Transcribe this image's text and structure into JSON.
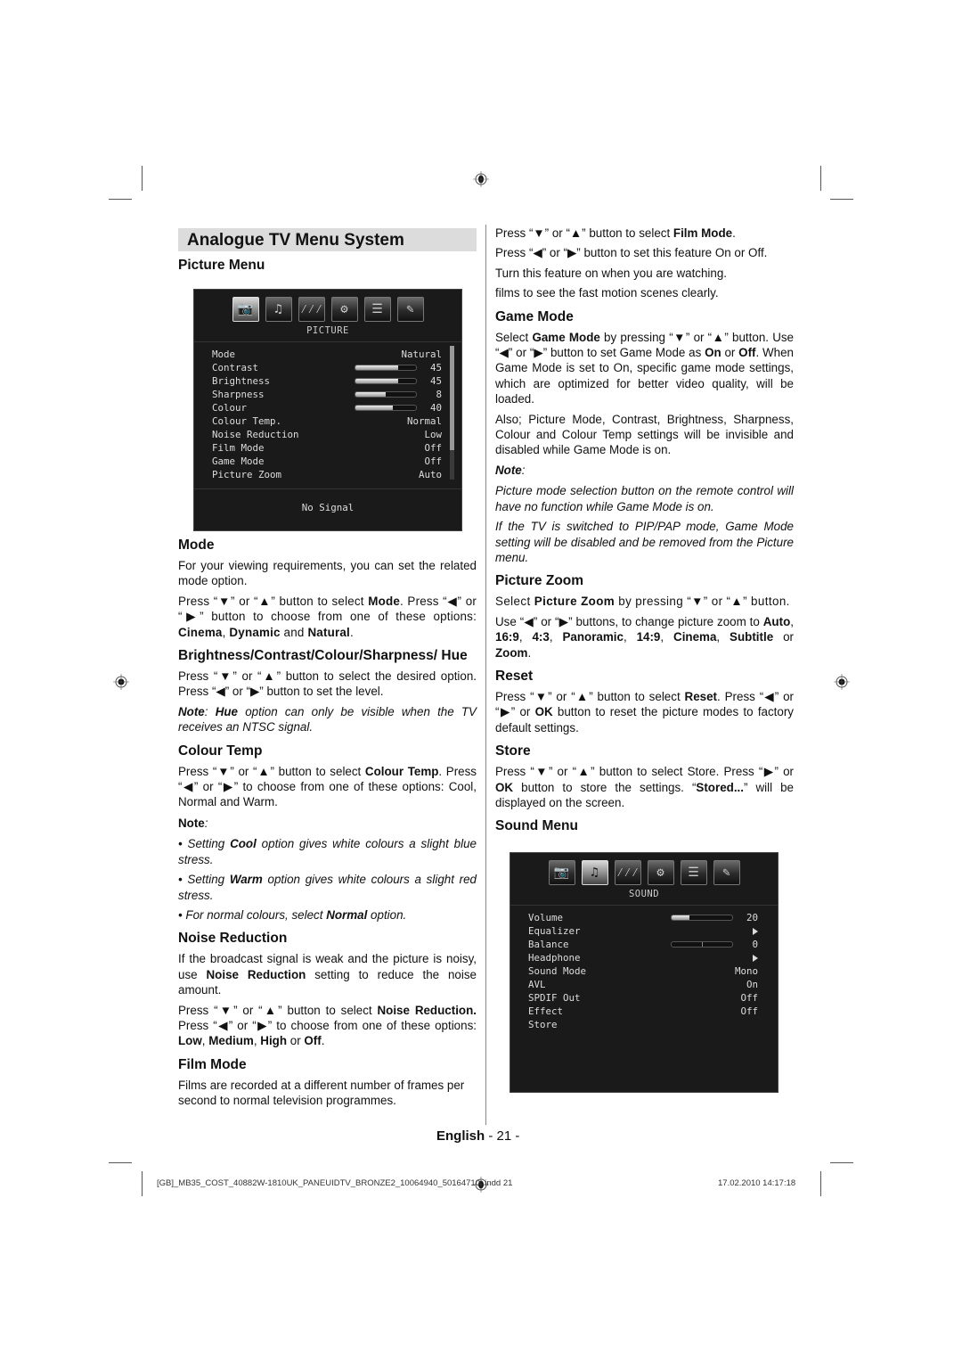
{
  "header": {
    "title": "Analogue TV Menu System",
    "subtitle": "Picture Menu"
  },
  "picture_osd": {
    "icons": [
      "camera-icon",
      "music-note-icon",
      "rain-lines-icon",
      "gears-icon",
      "document-list-icon",
      "tools-icon"
    ],
    "selected_icon": 0,
    "category": "PICTURE",
    "rows": [
      {
        "label": "Mode",
        "value": "Natural"
      },
      {
        "label": "Contrast",
        "value": "45",
        "level": 0.7
      },
      {
        "label": "Brightness",
        "value": "45",
        "level": 0.7
      },
      {
        "label": "Sharpness",
        "value": "8",
        "level": 0.5
      },
      {
        "label": "Colour",
        "value": "40",
        "level": 0.62
      },
      {
        "label": "Colour Temp.",
        "value": "Normal"
      },
      {
        "label": "Noise Reduction",
        "value": "Low"
      },
      {
        "label": "Film Mode",
        "value": "Off"
      },
      {
        "label": "Game Mode",
        "value": "Off"
      },
      {
        "label": "Picture Zoom",
        "value": "Auto"
      }
    ],
    "status": "No Signal",
    "scroll_fraction": 0.78
  },
  "left": {
    "mode": {
      "heading": "Mode",
      "p1": "For your viewing requirements, you can set the related mode option.",
      "p2_a": "Press “▼” or “▲” button to select ",
      "p2_b": "Mode",
      "p2_c": ". Press “◀” or “▶” button to choose from one of these options: ",
      "p2_d": "Cinema",
      "p2_e": ",  ",
      "p2_f": "Dynamic",
      "p2_g": " and ",
      "p2_h": "Natural",
      "p2_i": "."
    },
    "bcsh": {
      "heading": "Brightness/Contrast/Colour/Sharpness/ Hue",
      "p1": "Press “▼” or “▲” button to select the desired option. Press “◀” or “▶” button to set the level.",
      "note_a": "Note",
      "note_b": ": ",
      "note_c": "Hue",
      "note_d": " option can only be visible when the TV receives an NTSC signal."
    },
    "colour_temp": {
      "heading": "Colour Temp",
      "p1_a": "Press “▼” or “▲” button to select ",
      "p1_b": "Colour Temp",
      "p1_c": ". Press “◀” or “▶” to choose from one of these options: Cool, Normal and Warm.",
      "note": "Note",
      "note_colon": ":",
      "b1_a": "• Setting ",
      "b1_b": "Cool",
      "b1_c": " option gives white colours a slight blue stress.",
      "b2_a": "• Setting ",
      "b2_b": "Warm",
      "b2_c": " option gives white colours a slight red stress.",
      "b3_a": "• For normal colours, select ",
      "b3_b": "Normal",
      "b3_c": " option."
    },
    "noise": {
      "heading": "Noise Reduction",
      "p1_a": "If the broadcast signal is weak and the picture is noisy, use ",
      "p1_b": "Noise Reduction",
      "p1_c": " setting to reduce the noise amount.",
      "p2_a": "Press “▼” or “▲” button to select ",
      "p2_b": "Noise Reduction.",
      "p2_c": " Press “◀” or “▶” to choose from one of these options: ",
      "p2_d": "Low",
      "p2_e": ", ",
      "p2_f": "Medium",
      "p2_g": ", ",
      "p2_h": "High",
      "p2_i": " or ",
      "p2_j": "Off",
      "p2_k": "."
    },
    "film": {
      "heading": "Film Mode",
      "p1": "Films are recorded at a different number of frames per second to normal television programmes."
    }
  },
  "right": {
    "film_cont": {
      "l1_a": "Press “▼” or “▲” button to select ",
      "l1_b": "Film Mode",
      "l1_c": ".",
      "l2": "Press “◀” or “▶” button to set this feature On or Off.",
      "l3": "Turn this feature on when you are watching.",
      "l4": "films to see the fast motion scenes clearly."
    },
    "game": {
      "heading": "Game Mode",
      "p1_a": "Select ",
      "p1_b": "Game Mode",
      "p1_c": " by pressing “▼” or “▲” button. Use “◀” or “▶” button to set Game Mode as ",
      "p1_d": "On",
      "p1_e": " or ",
      "p1_f": "Off",
      "p1_g": ". When Game Mode is set to On, specific game mode settings, which are optimized for better video quality, will be loaded.",
      "p2": "Also; Picture Mode, Contrast, Brightness, Sharpness, Colour and Colour Temp settings will be invisible and disabled while Game Mode is on.",
      "note": "Note",
      "note_colon": ":",
      "n1": "Picture mode selection button on the remote control will have no function while Game Mode is on.",
      "n2": "If the TV is switched to PIP/PAP mode, Game Mode setting will be disabled and be removed from the Picture menu."
    },
    "zoom": {
      "heading": "Picture Zoom",
      "p1_a": "Select ",
      "p1_b": "Picture Zoom",
      "p1_c": " by pressing “▼” or “▲” button.",
      "p2_a": "Use “◀” or “▶” buttons, to change picture zoom  to ",
      "opts": [
        "Auto",
        "16:9",
        "4:3",
        "Panoramic",
        "14:9",
        "Cinema",
        "Subtitle"
      ],
      "p2_or": " or ",
      "p2_last": "Zoom",
      "p2_end": "."
    },
    "reset": {
      "heading": "Reset",
      "p1_a": "Press “▼” or “▲” button to select ",
      "p1_b": "Reset",
      "p1_c": ". Press “◀” or “▶” or ",
      "p1_d": "OK",
      "p1_e": " button to reset the picture modes to factory default settings."
    },
    "store": {
      "heading": "Store",
      "p1_a": "Press “▼” or “▲” button to select Store. Press “▶” or ",
      "p1_b": "OK",
      "p1_c": " button to store the settings. “",
      "p1_d": "Stored...",
      "p1_e": "” will be displayed on the screen."
    },
    "sound_heading": "Sound Menu"
  },
  "sound_osd": {
    "icons": [
      "camera-icon",
      "music-note-icon",
      "rain-lines-icon",
      "gears-icon",
      "document-list-icon",
      "tools-icon"
    ],
    "selected_icon": 1,
    "category": "SOUND",
    "rows": [
      {
        "label": "Volume",
        "value": "20",
        "level": 0.3
      },
      {
        "label": "Equalizer",
        "arrow": true
      },
      {
        "label": "Balance",
        "value": "0",
        "balance": true
      },
      {
        "label": "Headphone",
        "arrow": true
      },
      {
        "label": "Sound Mode",
        "value": "Mono"
      },
      {
        "label": "AVL",
        "value": "On"
      },
      {
        "label": "SPDIF Out",
        "value": "Off"
      },
      {
        "label": "Effect",
        "value": "Off"
      },
      {
        "label": "Store",
        "value": ""
      }
    ]
  },
  "footer": {
    "language": "English",
    "page": " - 21 -",
    "slug_left": "[GB]_MB35_COST_40882W-1810UK_PANEUIDTV_BRONZE2_10064940_50164710..indd  21",
    "slug_right": "17.02.2010   14:17:18"
  }
}
